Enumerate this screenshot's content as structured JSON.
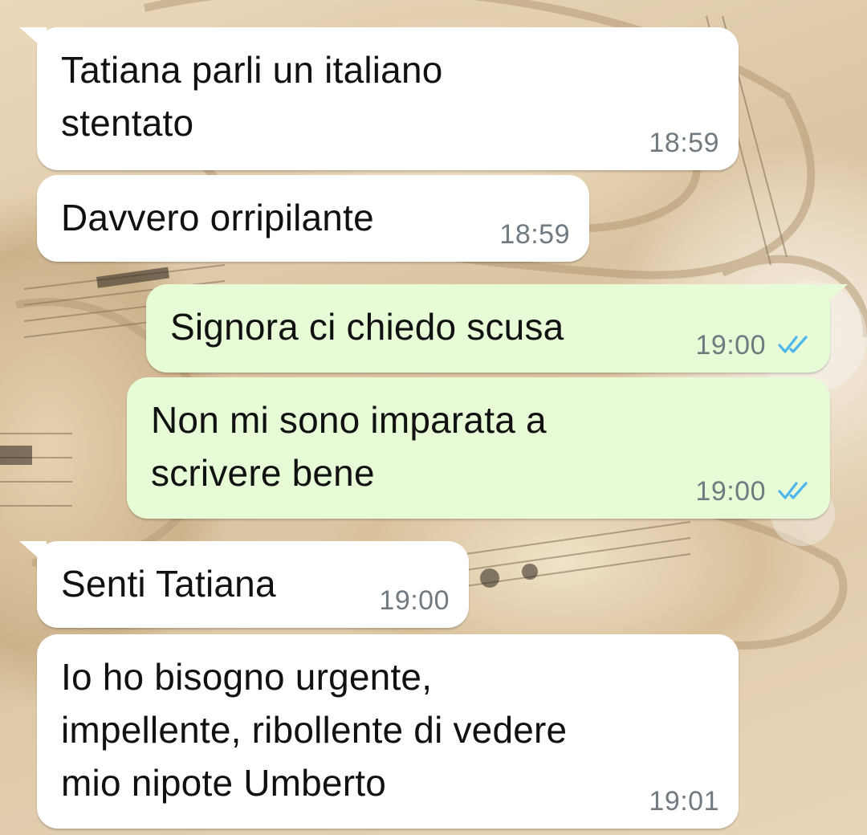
{
  "chat": {
    "messages": [
      {
        "direction": "incoming",
        "text": "Tatiana parli un italiano\nstentato",
        "time": "18:59"
      },
      {
        "direction": "incoming",
        "text": "Davvero orripilante",
        "time": "18:59"
      },
      {
        "direction": "outgoing",
        "text": "Signora ci chiedo scusa",
        "time": "19:00",
        "status": "read",
        "status_icon": "double-check-icon"
      },
      {
        "direction": "outgoing",
        "text": "Non mi sono imparata a\nscrivere bene",
        "time": "19:00",
        "status": "read",
        "status_icon": "double-check-icon"
      },
      {
        "direction": "incoming",
        "text": "Senti Tatiana",
        "time": "19:00"
      },
      {
        "direction": "incoming",
        "text": "Io ho bisogno urgente,\nimpellente, ribollente di vedere\nmio nipote Umberto",
        "time": "19:01"
      }
    ]
  },
  "colors": {
    "incoming_bubble": "#ffffff",
    "outgoing_bubble": "#e7fcd6",
    "time_text": "#707a80",
    "read_ticks": "#4fb6ec"
  }
}
